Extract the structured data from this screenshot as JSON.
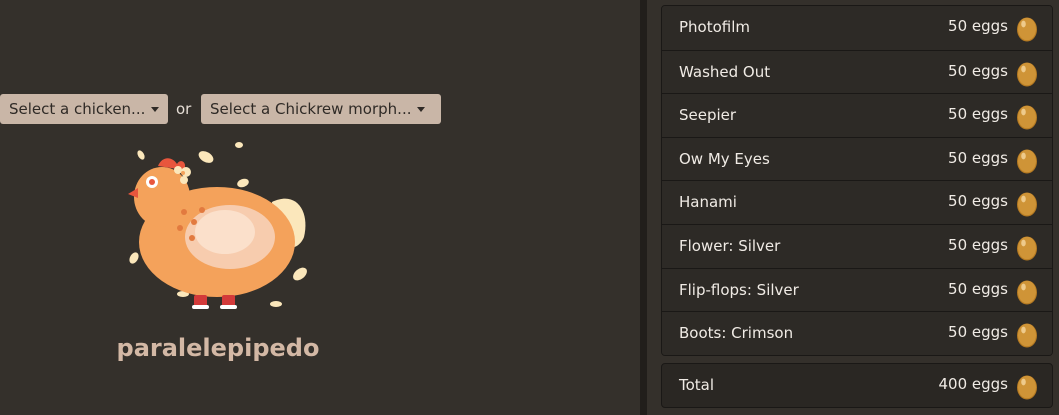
{
  "selectors": {
    "chicken_label": "Select a chicken...",
    "or_label": "or",
    "morph_label": "Select a Chickrew morph..."
  },
  "preview": {
    "chicken_name": "paralelepipedo",
    "icon": "chicken-icon"
  },
  "items": [
    {
      "name": "Photofilm",
      "price": "50 eggs"
    },
    {
      "name": "Washed Out",
      "price": "50 eggs"
    },
    {
      "name": "Seepier",
      "price": "50 eggs"
    },
    {
      "name": "Ow My Eyes",
      "price": "50 eggs"
    },
    {
      "name": "Hanami",
      "price": "50 eggs"
    },
    {
      "name": "Flower: Silver",
      "price": "50 eggs"
    },
    {
      "name": "Flip-flops: Silver",
      "price": "50 eggs"
    },
    {
      "name": "Boots: Crimson",
      "price": "50 eggs"
    }
  ],
  "total": {
    "label": "Total",
    "price": "400 eggs"
  },
  "colors": {
    "background": "#34302b",
    "select_button": "#c9b6a7",
    "chicken_name": "#d3b8a5",
    "egg": "#c88b2e"
  }
}
